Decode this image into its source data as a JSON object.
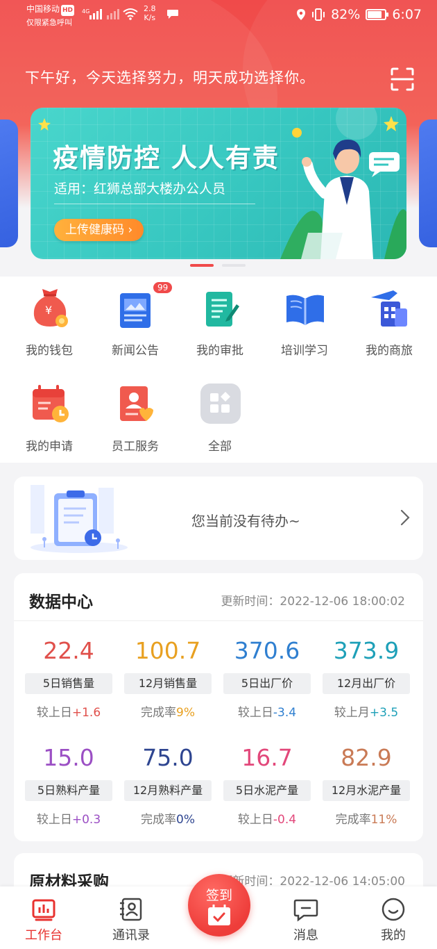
{
  "status_bar": {
    "carrier": "中国移动",
    "hd": "HD",
    "emergency": "仅限紧急呼叫",
    "speed_value": "2.8",
    "speed_unit": "K/s",
    "battery": "82%",
    "time": "6:07"
  },
  "header": {
    "greeting": "下午好，今天选择努力，明天成功选择你。"
  },
  "banner": {
    "title": "疫情防控  人人有责",
    "subtitle": "适用：红狮总部大楼办公人员",
    "button": "上传健康码 ›"
  },
  "apps": [
    {
      "label": "我的钱包",
      "icon": "wallet-icon"
    },
    {
      "label": "新闻公告",
      "icon": "news-icon",
      "badge": "99"
    },
    {
      "label": "我的审批",
      "icon": "approval-icon"
    },
    {
      "label": "培训学习",
      "icon": "book-icon"
    },
    {
      "label": "我的商旅",
      "icon": "travel-icon"
    },
    {
      "label": "我的申请",
      "icon": "calendar-icon"
    },
    {
      "label": "员工服务",
      "icon": "staff-icon"
    },
    {
      "label": "全部",
      "icon": "all-apps-icon"
    }
  ],
  "todo": {
    "text": "您当前没有待办~"
  },
  "data_center": {
    "title": "数据中心",
    "update_time": "更新时间：2022-12-06 18:00:02",
    "metrics": [
      {
        "value": "22.4",
        "name": "5日销售量",
        "cmp_label": "较上日",
        "cmp_value": "+1.6",
        "color": "#e0504b",
        "cmp_color": "#e0504b"
      },
      {
        "value": "100.7",
        "name": "12月销售量",
        "cmp_label": "完成率",
        "cmp_value": "9%",
        "color": "#e8a020",
        "cmp_color": "#e8a020"
      },
      {
        "value": "370.6",
        "name": "5日出厂价",
        "cmp_label": "较上日",
        "cmp_value": "-3.4",
        "color": "#2f7fd0",
        "cmp_color": "#2f7fd0"
      },
      {
        "value": "373.9",
        "name": "12月出厂价",
        "cmp_label": "较上月",
        "cmp_value": "+3.5",
        "color": "#1ea0b8",
        "cmp_color": "#1ea0b8"
      },
      {
        "value": "15.0",
        "name": "5日熟料产量",
        "cmp_label": "较上日",
        "cmp_value": "+0.3",
        "color": "#9b4fc4",
        "cmp_color": "#9b4fc4"
      },
      {
        "value": "75.0",
        "name": "12月熟料产量",
        "cmp_label": "完成率",
        "cmp_value": "0%",
        "color": "#2e4590",
        "cmp_color": "#2e4590"
      },
      {
        "value": "16.7",
        "name": "5日水泥产量",
        "cmp_label": "较上日",
        "cmp_value": "-0.4",
        "color": "#e2477a",
        "cmp_color": "#e2477a"
      },
      {
        "value": "82.9",
        "name": "12月水泥产量",
        "cmp_label": "完成率",
        "cmp_value": "11%",
        "color": "#c97a55",
        "cmp_color": "#c97a55"
      }
    ]
  },
  "raw_material": {
    "title": "原材料采购",
    "time": "更新时间：2022-12-06 14:05:00"
  },
  "tabbar": {
    "workbench": "工作台",
    "contacts": "通讯录",
    "checkin": "签到",
    "messages": "消息",
    "mine": "我的"
  },
  "colors": {
    "brand_red": "#f04a4a",
    "banner_teal": "#37c7c0",
    "accent_orange": "#ff9a30"
  }
}
